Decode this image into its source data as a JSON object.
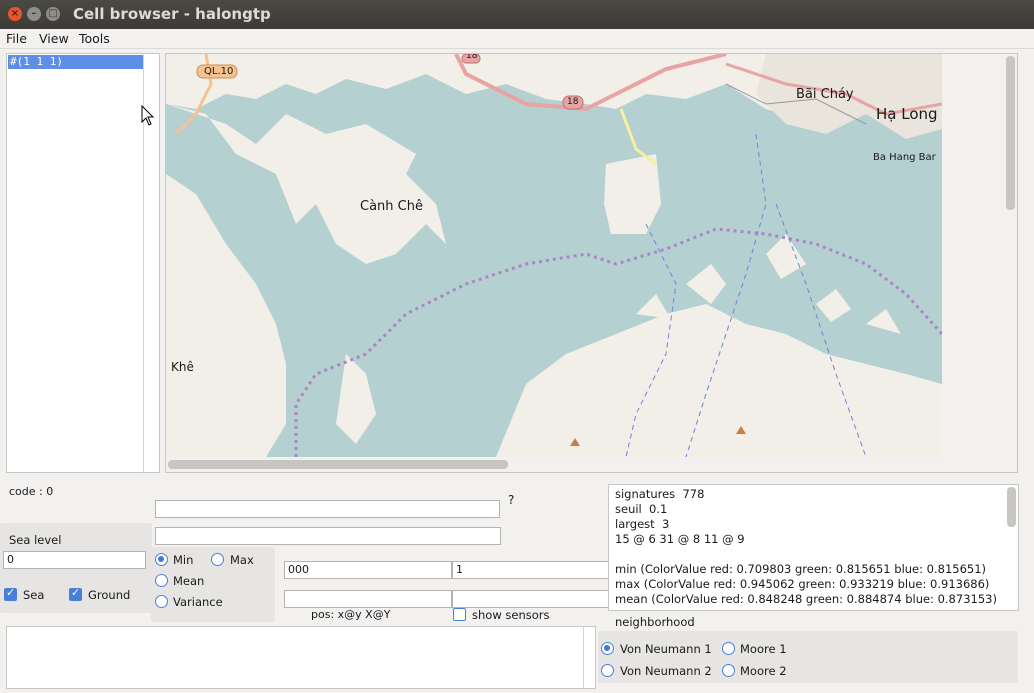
{
  "window": {
    "title": "Cell browser - halongtp",
    "close_glyph": "×",
    "min_glyph": "–",
    "max_glyph": "□"
  },
  "menu": {
    "file": "File",
    "view": "View",
    "tools": "Tools"
  },
  "list": {
    "selected": "#(1 1 1)"
  },
  "map": {
    "places": {
      "bai_chay": "Bãi Cháy",
      "ha_long": "Hạ Long",
      "ba_hang_bar": "Ba Hang Bar",
      "canh_che": "Cành Chê",
      "khe": "Khê",
      "ql10": "QL.10",
      "r18a": "18",
      "r18b": "18"
    },
    "colors": {
      "water": "#b5d0d0",
      "land": "#f2efe9",
      "road": "#e8a3a3",
      "boundary": "#ac85c5"
    }
  },
  "code_label": "code : 0",
  "question": "?",
  "sea_level": {
    "label": "Sea level",
    "value": "0"
  },
  "checks": {
    "sea": "Sea",
    "ground": "Ground"
  },
  "stats": {
    "min": "Min",
    "max": "Max",
    "mean": "Mean",
    "variance": "Variance"
  },
  "fields": {
    "a": "000",
    "b": "1"
  },
  "pos_label": "pos: x@y X@Y",
  "show_sensors": "show sensors",
  "info": {
    "l1": "signatures  778",
    "l2": "seuil  0.1",
    "l3": "largest  3",
    "l4": "15 @ 6 31 @ 8 11 @ 9",
    "l5": "min (ColorValue red: 0.709803 green: 0.815651 blue: 0.815651)",
    "l6": "max (ColorValue red: 0.945062 green: 0.933219 blue: 0.913686)",
    "l7": "mean (ColorValue red: 0.848248 green: 0.884874 blue: 0.873153)"
  },
  "neighborhood": {
    "label": "neighborhood",
    "vn1": "Von Neumann 1",
    "vn2": "Von Neumann 2",
    "m1": "Moore 1",
    "m2": "Moore 2"
  }
}
